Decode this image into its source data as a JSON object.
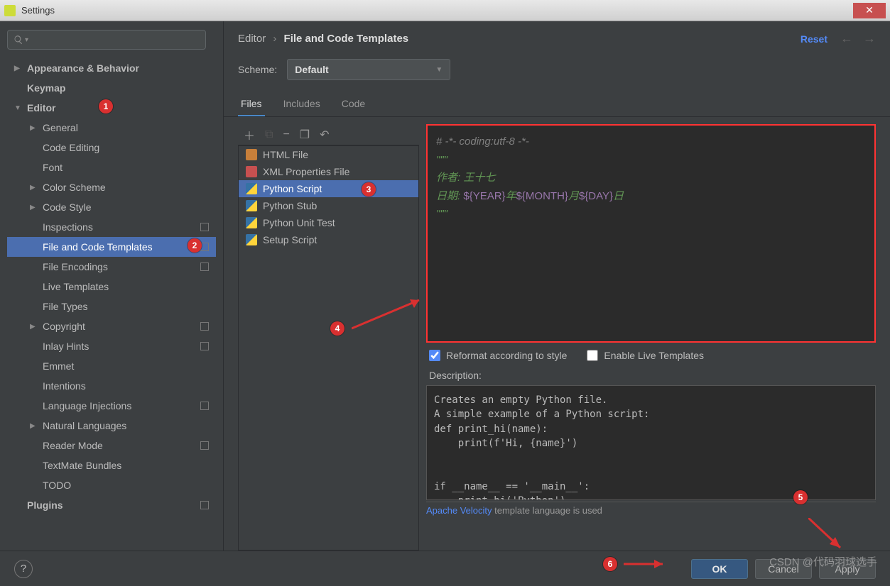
{
  "window": {
    "title": "Settings"
  },
  "sidebar": {
    "search_placeholder": "",
    "items": [
      {
        "label": "Appearance & Behavior",
        "level": 0,
        "chevron": "right",
        "bold": true
      },
      {
        "label": "Keymap",
        "level": 0,
        "chevron": "blank",
        "bold": true
      },
      {
        "label": "Editor",
        "level": 0,
        "chevron": "down",
        "bold": true,
        "badge": 1
      },
      {
        "label": "General",
        "level": 1,
        "chevron": "right"
      },
      {
        "label": "Code Editing",
        "level": 1,
        "chevron": "blank"
      },
      {
        "label": "Font",
        "level": 1,
        "chevron": "blank"
      },
      {
        "label": "Color Scheme",
        "level": 1,
        "chevron": "right"
      },
      {
        "label": "Code Style",
        "level": 1,
        "chevron": "right"
      },
      {
        "label": "Inspections",
        "level": 1,
        "chevron": "blank",
        "box": true
      },
      {
        "label": "File and Code Templates",
        "level": 1,
        "chevron": "blank",
        "box": true,
        "selected": true,
        "badge": 2
      },
      {
        "label": "File Encodings",
        "level": 1,
        "chevron": "blank",
        "box": true
      },
      {
        "label": "Live Templates",
        "level": 1,
        "chevron": "blank"
      },
      {
        "label": "File Types",
        "level": 1,
        "chevron": "blank"
      },
      {
        "label": "Copyright",
        "level": 1,
        "chevron": "right",
        "box": true
      },
      {
        "label": "Inlay Hints",
        "level": 1,
        "chevron": "blank",
        "box": true
      },
      {
        "label": "Emmet",
        "level": 1,
        "chevron": "blank"
      },
      {
        "label": "Intentions",
        "level": 1,
        "chevron": "blank"
      },
      {
        "label": "Language Injections",
        "level": 1,
        "chevron": "blank",
        "box": true
      },
      {
        "label": "Natural Languages",
        "level": 1,
        "chevron": "right"
      },
      {
        "label": "Reader Mode",
        "level": 1,
        "chevron": "blank",
        "box": true
      },
      {
        "label": "TextMate Bundles",
        "level": 1,
        "chevron": "blank"
      },
      {
        "label": "TODO",
        "level": 1,
        "chevron": "blank"
      },
      {
        "label": "Plugins",
        "level": 0,
        "chevron": "blank",
        "bold": true,
        "box": true
      }
    ]
  },
  "breadcrumb": {
    "parent": "Editor",
    "current": "File and Code Templates"
  },
  "reset": "Reset",
  "scheme": {
    "label": "Scheme:",
    "value": "Default"
  },
  "tabs": [
    {
      "label": "Files",
      "active": true
    },
    {
      "label": "Includes",
      "active": false
    },
    {
      "label": "Code",
      "active": false
    }
  ],
  "toolbar_icons": [
    "add",
    "copy-disabled",
    "remove",
    "duplicate",
    "undo"
  ],
  "templates": [
    {
      "label": "HTML File",
      "icon": "html"
    },
    {
      "label": "XML Properties File",
      "icon": "xml"
    },
    {
      "label": "Python Script",
      "icon": "py",
      "selected": true,
      "badge": 3
    },
    {
      "label": "Python Stub",
      "icon": "py"
    },
    {
      "label": "Python Unit Test",
      "icon": "py"
    },
    {
      "label": "Setup Script",
      "icon": "py"
    }
  ],
  "editor_code": {
    "line1": "# -*- coding:utf-8 -*-",
    "line2": "\"\"\"",
    "line3": "作者: 王十七",
    "line4_prefix": "日期: ",
    "line4_y": "${YEAR}",
    "line4_y_suf": "年",
    "line4_m": "${MONTH}",
    "line4_m_suf": "月",
    "line4_d": "${DAY}",
    "line4_d_suf": "日",
    "line5": "\"\"\""
  },
  "checkboxes": {
    "reformat": "Reformat according to style",
    "reformat_checked": true,
    "live": "Enable Live Templates",
    "live_checked": false
  },
  "description": {
    "label": "Description:",
    "text": "Creates an empty Python file.\nA simple example of a Python script:\ndef print_hi(name):\n    print(f'Hi, {name}')\n\n\nif __name__ == '__main__':\n    print_hi('Python')"
  },
  "footer_note": {
    "link": "Apache Velocity",
    "text": " template language is used"
  },
  "buttons": {
    "ok": "OK",
    "cancel": "Cancel",
    "apply": "Apply"
  },
  "annotations": {
    "b4": "4",
    "b5": "5",
    "b6": "6"
  },
  "watermark": "CSDN @代码羽球选手"
}
